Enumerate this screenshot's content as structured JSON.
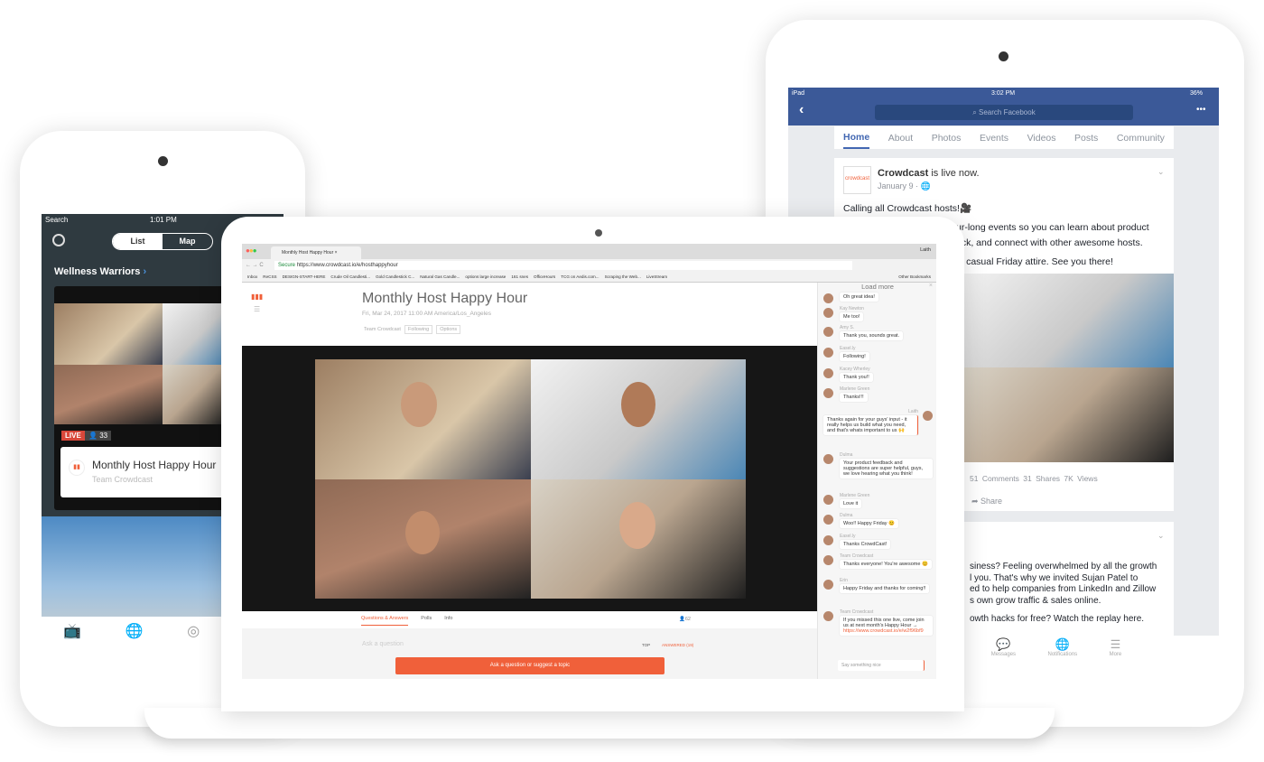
{
  "phone": {
    "status": {
      "back": "Search",
      "time": "1:01 PM"
    },
    "segments": [
      "List",
      "Map"
    ],
    "section": "Wellness Warriors",
    "live_badge": "LIVE",
    "viewer_count": "33",
    "event_title": "Monthly Host Happy Hour",
    "event_host": "Team Crowdcast",
    "tabs": [
      {
        "icon": "tv-icon"
      },
      {
        "icon": "globe-icon"
      },
      {
        "icon": "record-icon"
      },
      {
        "icon": "bell-icon"
      }
    ]
  },
  "browser": {
    "tab_title": "Monthly Host Happy Hour",
    "user": "Laith",
    "secure": "Secure",
    "url": "https://www.crowdcast.io/e/hosthappyhour",
    "bookmarks": [
      "Inbox",
      "ReCSS",
      "DESIGN-START-HERE",
      "Crude Oil Candlesti...",
      "Gold Candlestick C...",
      "Natural Gas Candle...",
      "options large increase",
      "161 snes",
      "OfficeHours",
      "TCG on Aedis.com...",
      "Scraping the Web...",
      "LiveStream"
    ],
    "other_bookmarks": "Other Bookmarks"
  },
  "event": {
    "title": "Monthly Host Happy Hour",
    "datetime": "Fri, Mar 24, 2017 11:00 AM America/Los_Angeles",
    "host": "Team Crowdcast",
    "following": "Following",
    "options": "Options",
    "tabs": [
      "Questions & Answers",
      "Polls",
      "Info"
    ],
    "attendees": "62",
    "ask_placeholder": "Ask a question",
    "sort": [
      "TOP",
      "ANSWERED (19)"
    ],
    "ask_button": "Ask a question or suggest a topic",
    "accent": "#f0603a"
  },
  "chat": {
    "load_more": "Load more",
    "messages": [
      {
        "name": "",
        "text": "Oh great idea!"
      },
      {
        "name": "Kay Newton",
        "text": "Me too!"
      },
      {
        "name": "Amy S.",
        "text": "Thank you, sounds great."
      },
      {
        "name": "Easel.ly",
        "text": "Following!"
      },
      {
        "name": "Kacey Wherley",
        "text": "Thank you!!"
      },
      {
        "name": "Marlene Green",
        "text": "Thanks!!!"
      },
      {
        "name": "Laith",
        "text": "Thanks again for your guys' input - it really helps us build what you need, and that's whats important to us 🙌"
      },
      {
        "name": "Dulma",
        "text": "Your product feedback and suggestions are super helpful, guys, we love hearing what you think!"
      },
      {
        "name": "Marlene Green",
        "text": "Love it"
      },
      {
        "name": "Dulma",
        "text": "Woo!! Happy Friday 😊"
      },
      {
        "name": "Easel.ly",
        "text": "Thanks CrowdCast!"
      },
      {
        "name": "Team Crowdcast",
        "text": "Thanks everyone! You're awesome 😊"
      },
      {
        "name": "Erin",
        "text": "Happy Friday and thanks for coming!!"
      },
      {
        "name": "Team Crowdcast",
        "text": "If you missed this one live, come join us at next month's Happy Hour →",
        "link": "https://www.crowdcast.io/e/w2f96bf9"
      }
    ],
    "input_placeholder": "Say something nice"
  },
  "ipad": {
    "status": {
      "device": "iPad",
      "time": "3:02 PM",
      "battery": "36%"
    },
    "search_placeholder": "Search Facebook",
    "tabs": [
      "Home",
      "About",
      "Photos",
      "Events",
      "Videos",
      "Posts",
      "Community"
    ],
    "brand_color": "#3b5998",
    "post": {
      "page": "Crowdcast",
      "action": "is live now.",
      "date": "January 9 · 🌐",
      "lines": [
        "Calling all Crowdcast hosts!🎥",
        "ur-long events so you can learn about product",
        "ack, and connect with other awesome hosts.",
        "st casual Friday attire. See you there!"
      ],
      "stats": [
        "51 Comments",
        "31 Shares",
        "7K Views"
      ],
      "share": "Share"
    },
    "post2": {
      "lines": [
        "siness? Feeling overwhelmed by all the growth",
        "l you. That's why we invited Sujan Patel to",
        "ed to help companies from LinkedIn and Zillow",
        "s own grow traffic & sales online.",
        "owth hacks for free? Watch the replay here."
      ]
    },
    "bottom_tabs": [
      "Messages",
      "Notifications",
      "More"
    ]
  }
}
